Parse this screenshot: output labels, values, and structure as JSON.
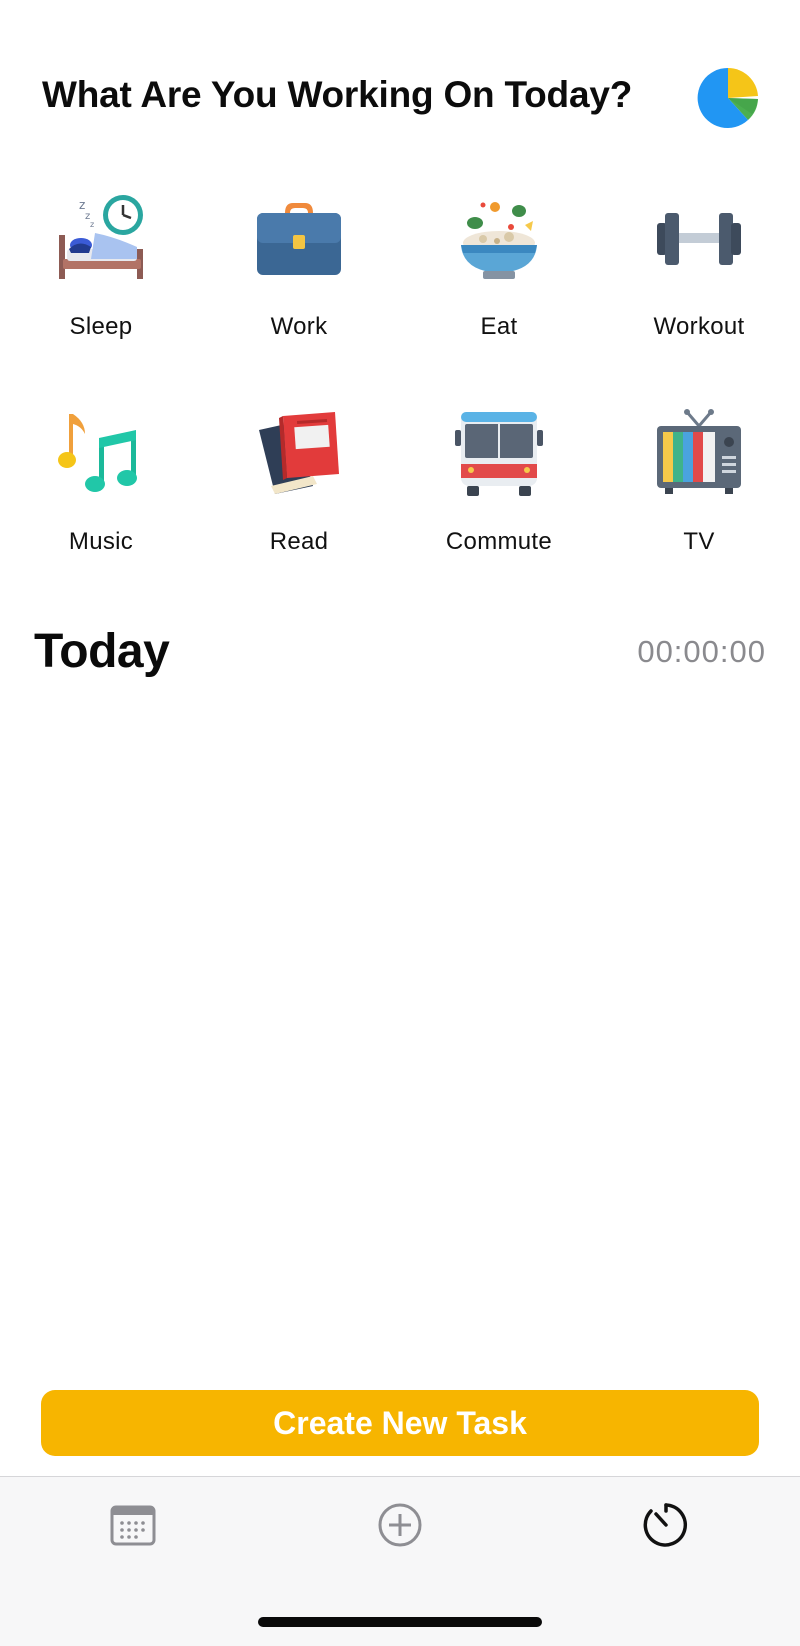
{
  "header": {
    "title": "What Are You Working On Today?",
    "stats_icon": "pie-chart-icon"
  },
  "categories": [
    {
      "label": "Sleep",
      "icon": "sleep-bed-clock-icon"
    },
    {
      "label": "Work",
      "icon": "briefcase-icon"
    },
    {
      "label": "Eat",
      "icon": "salad-bowl-icon"
    },
    {
      "label": "Workout",
      "icon": "dumbbell-icon"
    },
    {
      "label": "Music",
      "icon": "music-notes-icon"
    },
    {
      "label": "Read",
      "icon": "books-icon"
    },
    {
      "label": "Commute",
      "icon": "bus-icon"
    },
    {
      "label": "TV",
      "icon": "tv-icon"
    }
  ],
  "today": {
    "title": "Today",
    "total_time": "00:00:00"
  },
  "create_button": {
    "label": "Create New Task"
  },
  "tabbar": {
    "tabs": [
      {
        "icon": "calendar-icon",
        "active": false
      },
      {
        "icon": "plus-circle-icon",
        "active": false
      },
      {
        "icon": "timer-icon",
        "active": true
      }
    ]
  },
  "colors": {
    "accent": "#f7b500",
    "timer_text": "#8a8a8e",
    "tab_inactive": "#8e8e93",
    "tab_active": "#111111"
  }
}
